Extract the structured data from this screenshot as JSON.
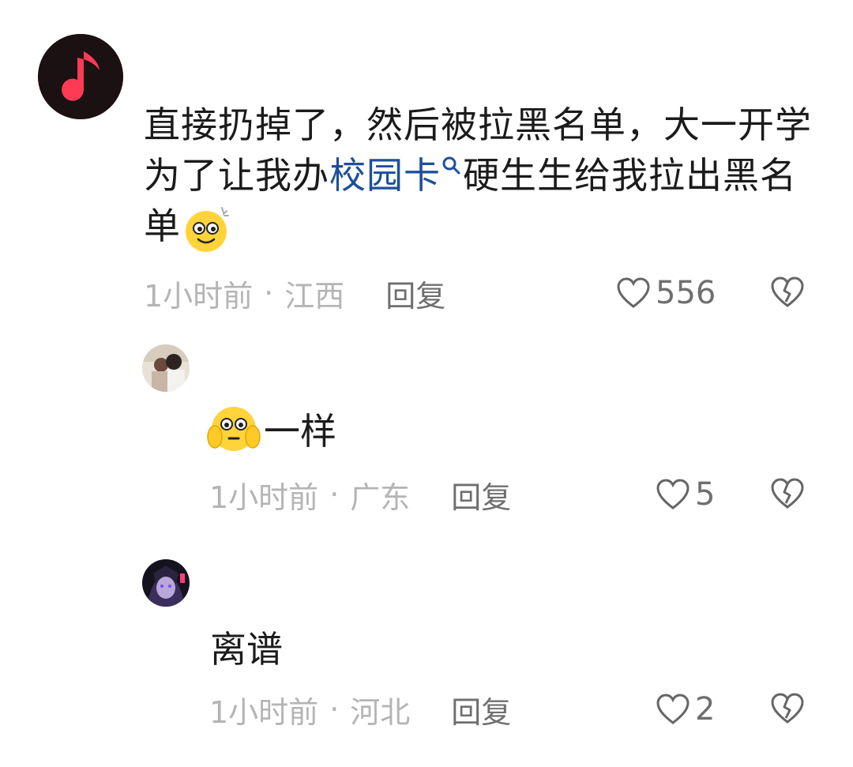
{
  "comments": [
    {
      "text_part1": "直接扔掉了，然后被拉黑名单，大一开学为了让我办",
      "link_text": "校园卡",
      "search_icon": "search-icon",
      "text_part2": "硬生生给我拉出黑名单",
      "emoji": "dizzy-face-emoji",
      "time": "1小时前",
      "separator": "·",
      "location": "江西",
      "reply_label": "回复",
      "likes": "556",
      "avatar_icon": "music-note-icon",
      "accent": "#ff3355"
    },
    {
      "emoji": "flushed-hands-emoji",
      "text": "一样",
      "time": "1小时前",
      "separator": "·",
      "location": "广东",
      "reply_label": "回复",
      "likes": "5"
    },
    {
      "text": "离谱",
      "time": "1小时前",
      "separator": "·",
      "location": "河北",
      "reply_label": "回复",
      "likes": "2"
    }
  ]
}
